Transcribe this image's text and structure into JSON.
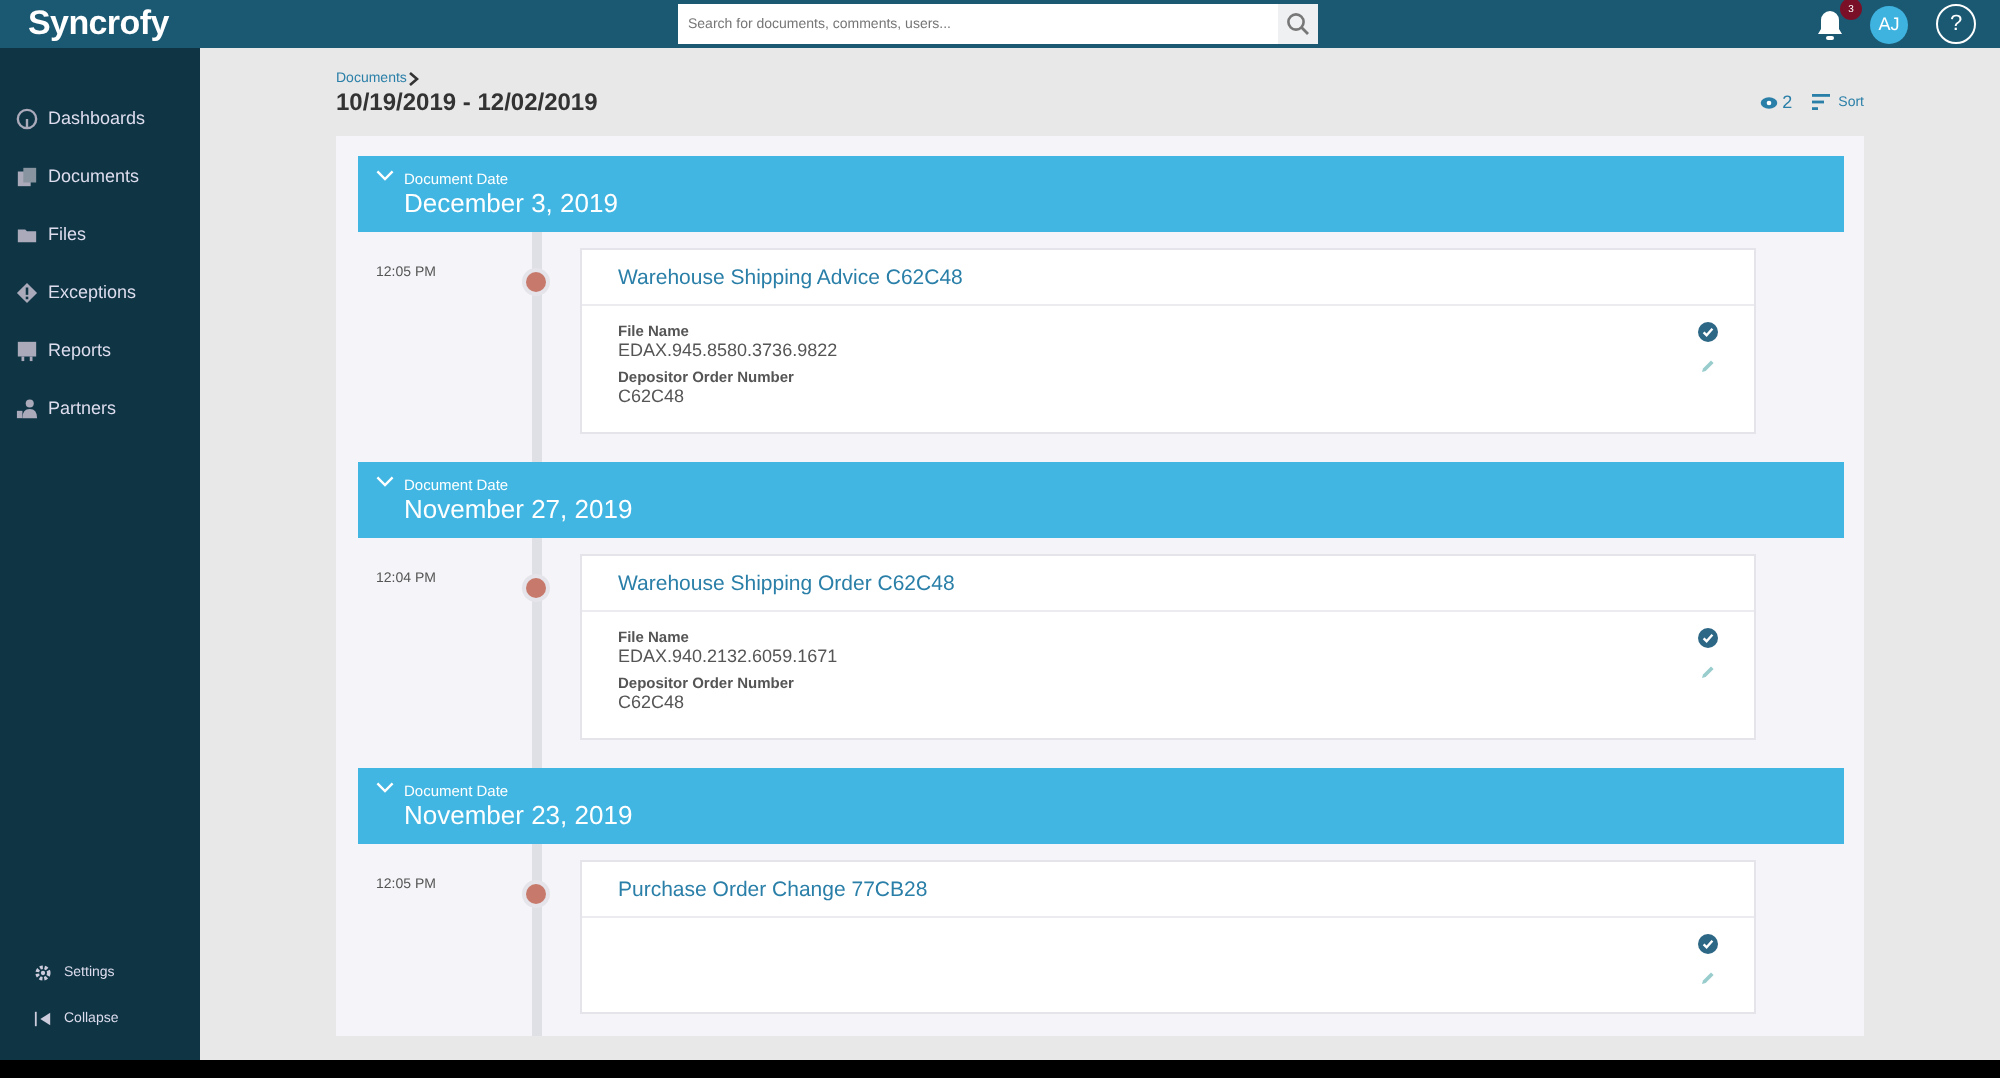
{
  "header": {
    "logo": "Syncrofy",
    "search": {
      "placeholder": "Search for documents, comments, users..."
    },
    "notifications": "3",
    "avatar": "AJ",
    "help": "?"
  },
  "sidebar": {
    "items": [
      {
        "label": "Dashboards",
        "kind": "gauge"
      },
      {
        "label": "Documents",
        "kind": "docs"
      },
      {
        "label": "Files",
        "kind": "folder"
      },
      {
        "label": "Exceptions",
        "kind": "alert"
      },
      {
        "label": "Reports",
        "kind": "chart"
      },
      {
        "label": "Partners",
        "kind": "people"
      }
    ],
    "footer": [
      {
        "label": "Settings",
        "kind": "gear"
      },
      {
        "label": "Collapse",
        "kind": "collapse"
      }
    ]
  },
  "breadcrumb": "Documents",
  "range": "10/19/2019 - 12/02/2019",
  "watchers": "2",
  "sort": "Sort",
  "groups": [
    {
      "caption": "Document Date",
      "date": "December 3, 2019",
      "expanded": true,
      "entries": [
        {
          "time": "12:05 PM",
          "title": "Warehouse Shipping Advice C62C48",
          "fields": [
            {
              "label": "File Name",
              "value": "EDAX.945.8580.3736.9822"
            },
            {
              "label": "Depositor Order Number",
              "value": "C62C48"
            }
          ]
        }
      ]
    },
    {
      "caption": "Document Date",
      "date": "November 27, 2019",
      "expanded": true,
      "entries": [
        {
          "time": "12:04 PM",
          "title": "Warehouse Shipping Order C62C48",
          "fields": [
            {
              "label": "File Name",
              "value": "EDAX.940.2132.6059.1671"
            },
            {
              "label": "Depositor Order Number",
              "value": "C62C48"
            }
          ]
        }
      ]
    },
    {
      "caption": "Document Date",
      "date": "November 23, 2019",
      "expanded": true,
      "entries": [
        {
          "time": "12:05 PM",
          "title": "Purchase Order Change 77CB28"
        }
      ]
    }
  ]
}
